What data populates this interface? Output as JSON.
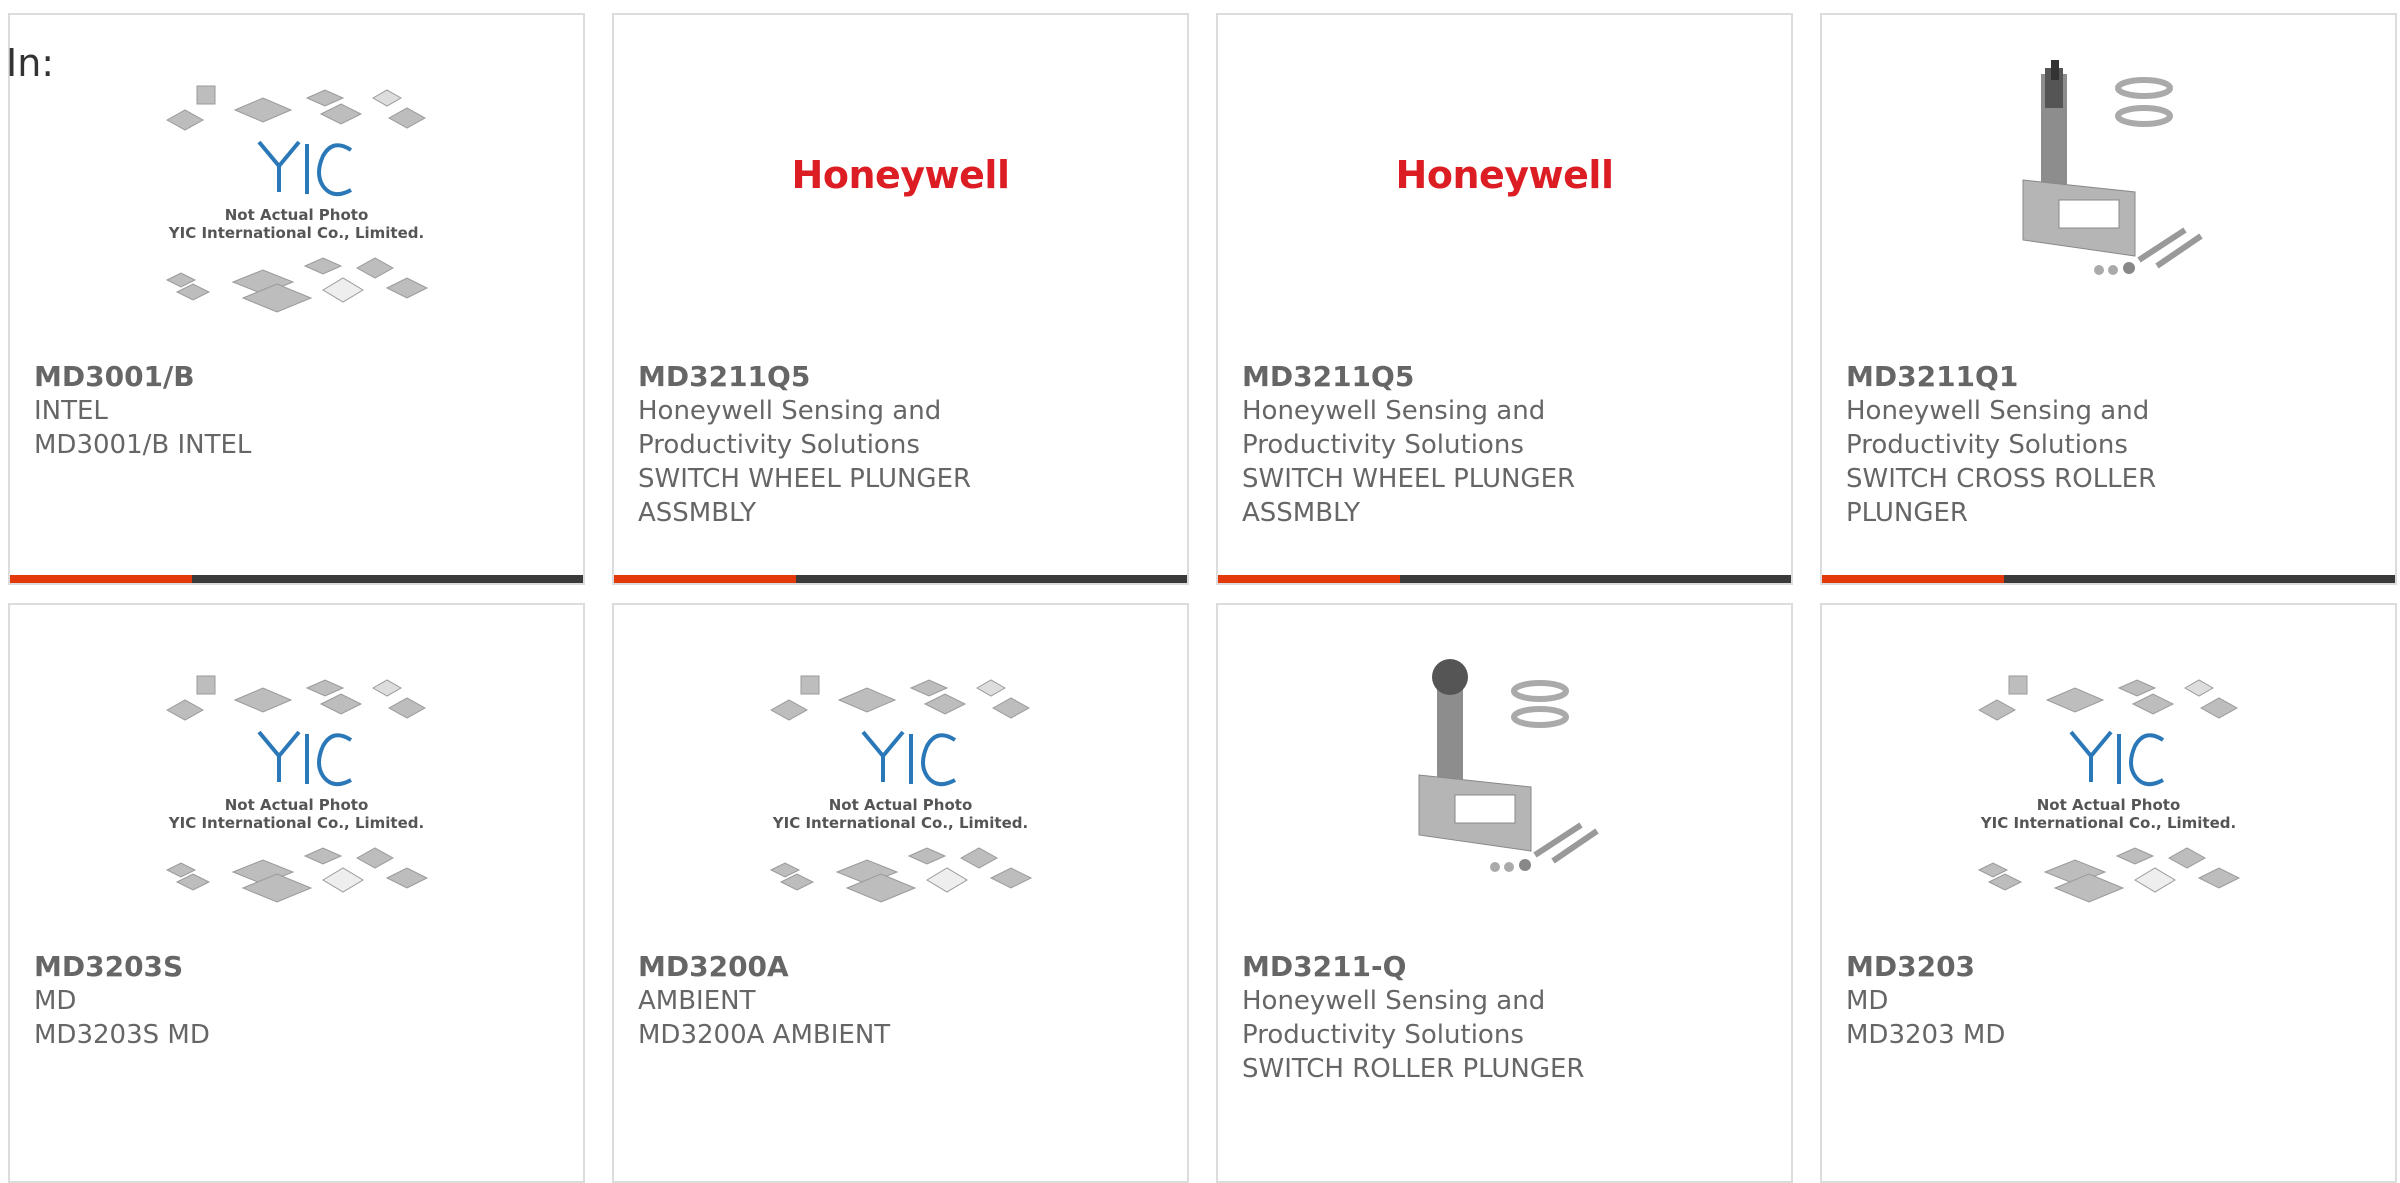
{
  "filter_label": "In:",
  "placeholder_caption": {
    "line1": "Not Actual Photo",
    "line2": "YIC International Co., Limited."
  },
  "brand_logo_text": "Honeywell",
  "colors": {
    "accent_bar": "#e2380b",
    "bar_dark": "#3a3a3a",
    "honeywell_red": "#dc1e24",
    "yic_blue": "#2b78b8"
  },
  "products": [
    {
      "part": "MD3001/B",
      "line1": "INTEL",
      "line2": "MD3001/B INTEL",
      "line3": "",
      "line4": "",
      "image": "yic-placeholder"
    },
    {
      "part": "MD3211Q5",
      "line1": "Honeywell Sensing and",
      "line2": "Productivity Solutions",
      "line3": "SWITCH WHEEL PLUNGER",
      "line4": "ASSMBLY",
      "image": "honeywell-logo"
    },
    {
      "part": "MD3211Q5",
      "line1": "Honeywell Sensing and",
      "line2": "Productivity Solutions",
      "line3": "SWITCH WHEEL PLUNGER",
      "line4": "ASSMBLY",
      "image": "honeywell-logo"
    },
    {
      "part": "MD3211Q1",
      "line1": "Honeywell Sensing and",
      "line2": "Productivity Solutions",
      "line3": "SWITCH CROSS ROLLER",
      "line4": "PLUNGER",
      "image": "plunger-photo"
    },
    {
      "part": "MD3203S",
      "line1": "MD",
      "line2": "MD3203S MD",
      "line3": "",
      "line4": "",
      "image": "yic-placeholder"
    },
    {
      "part": "MD3200A",
      "line1": "AMBIENT",
      "line2": "MD3200A AMBIENT",
      "line3": "",
      "line4": "",
      "image": "yic-placeholder"
    },
    {
      "part": "MD3211-Q",
      "line1": "Honeywell Sensing and",
      "line2": "Productivity Solutions",
      "line3": "SWITCH ROLLER PLUNGER",
      "line4": "",
      "image": "plunger-photo"
    },
    {
      "part": "MD3203",
      "line1": "MD",
      "line2": "MD3203 MD",
      "line3": "",
      "line4": "",
      "image": "yic-placeholder"
    }
  ]
}
